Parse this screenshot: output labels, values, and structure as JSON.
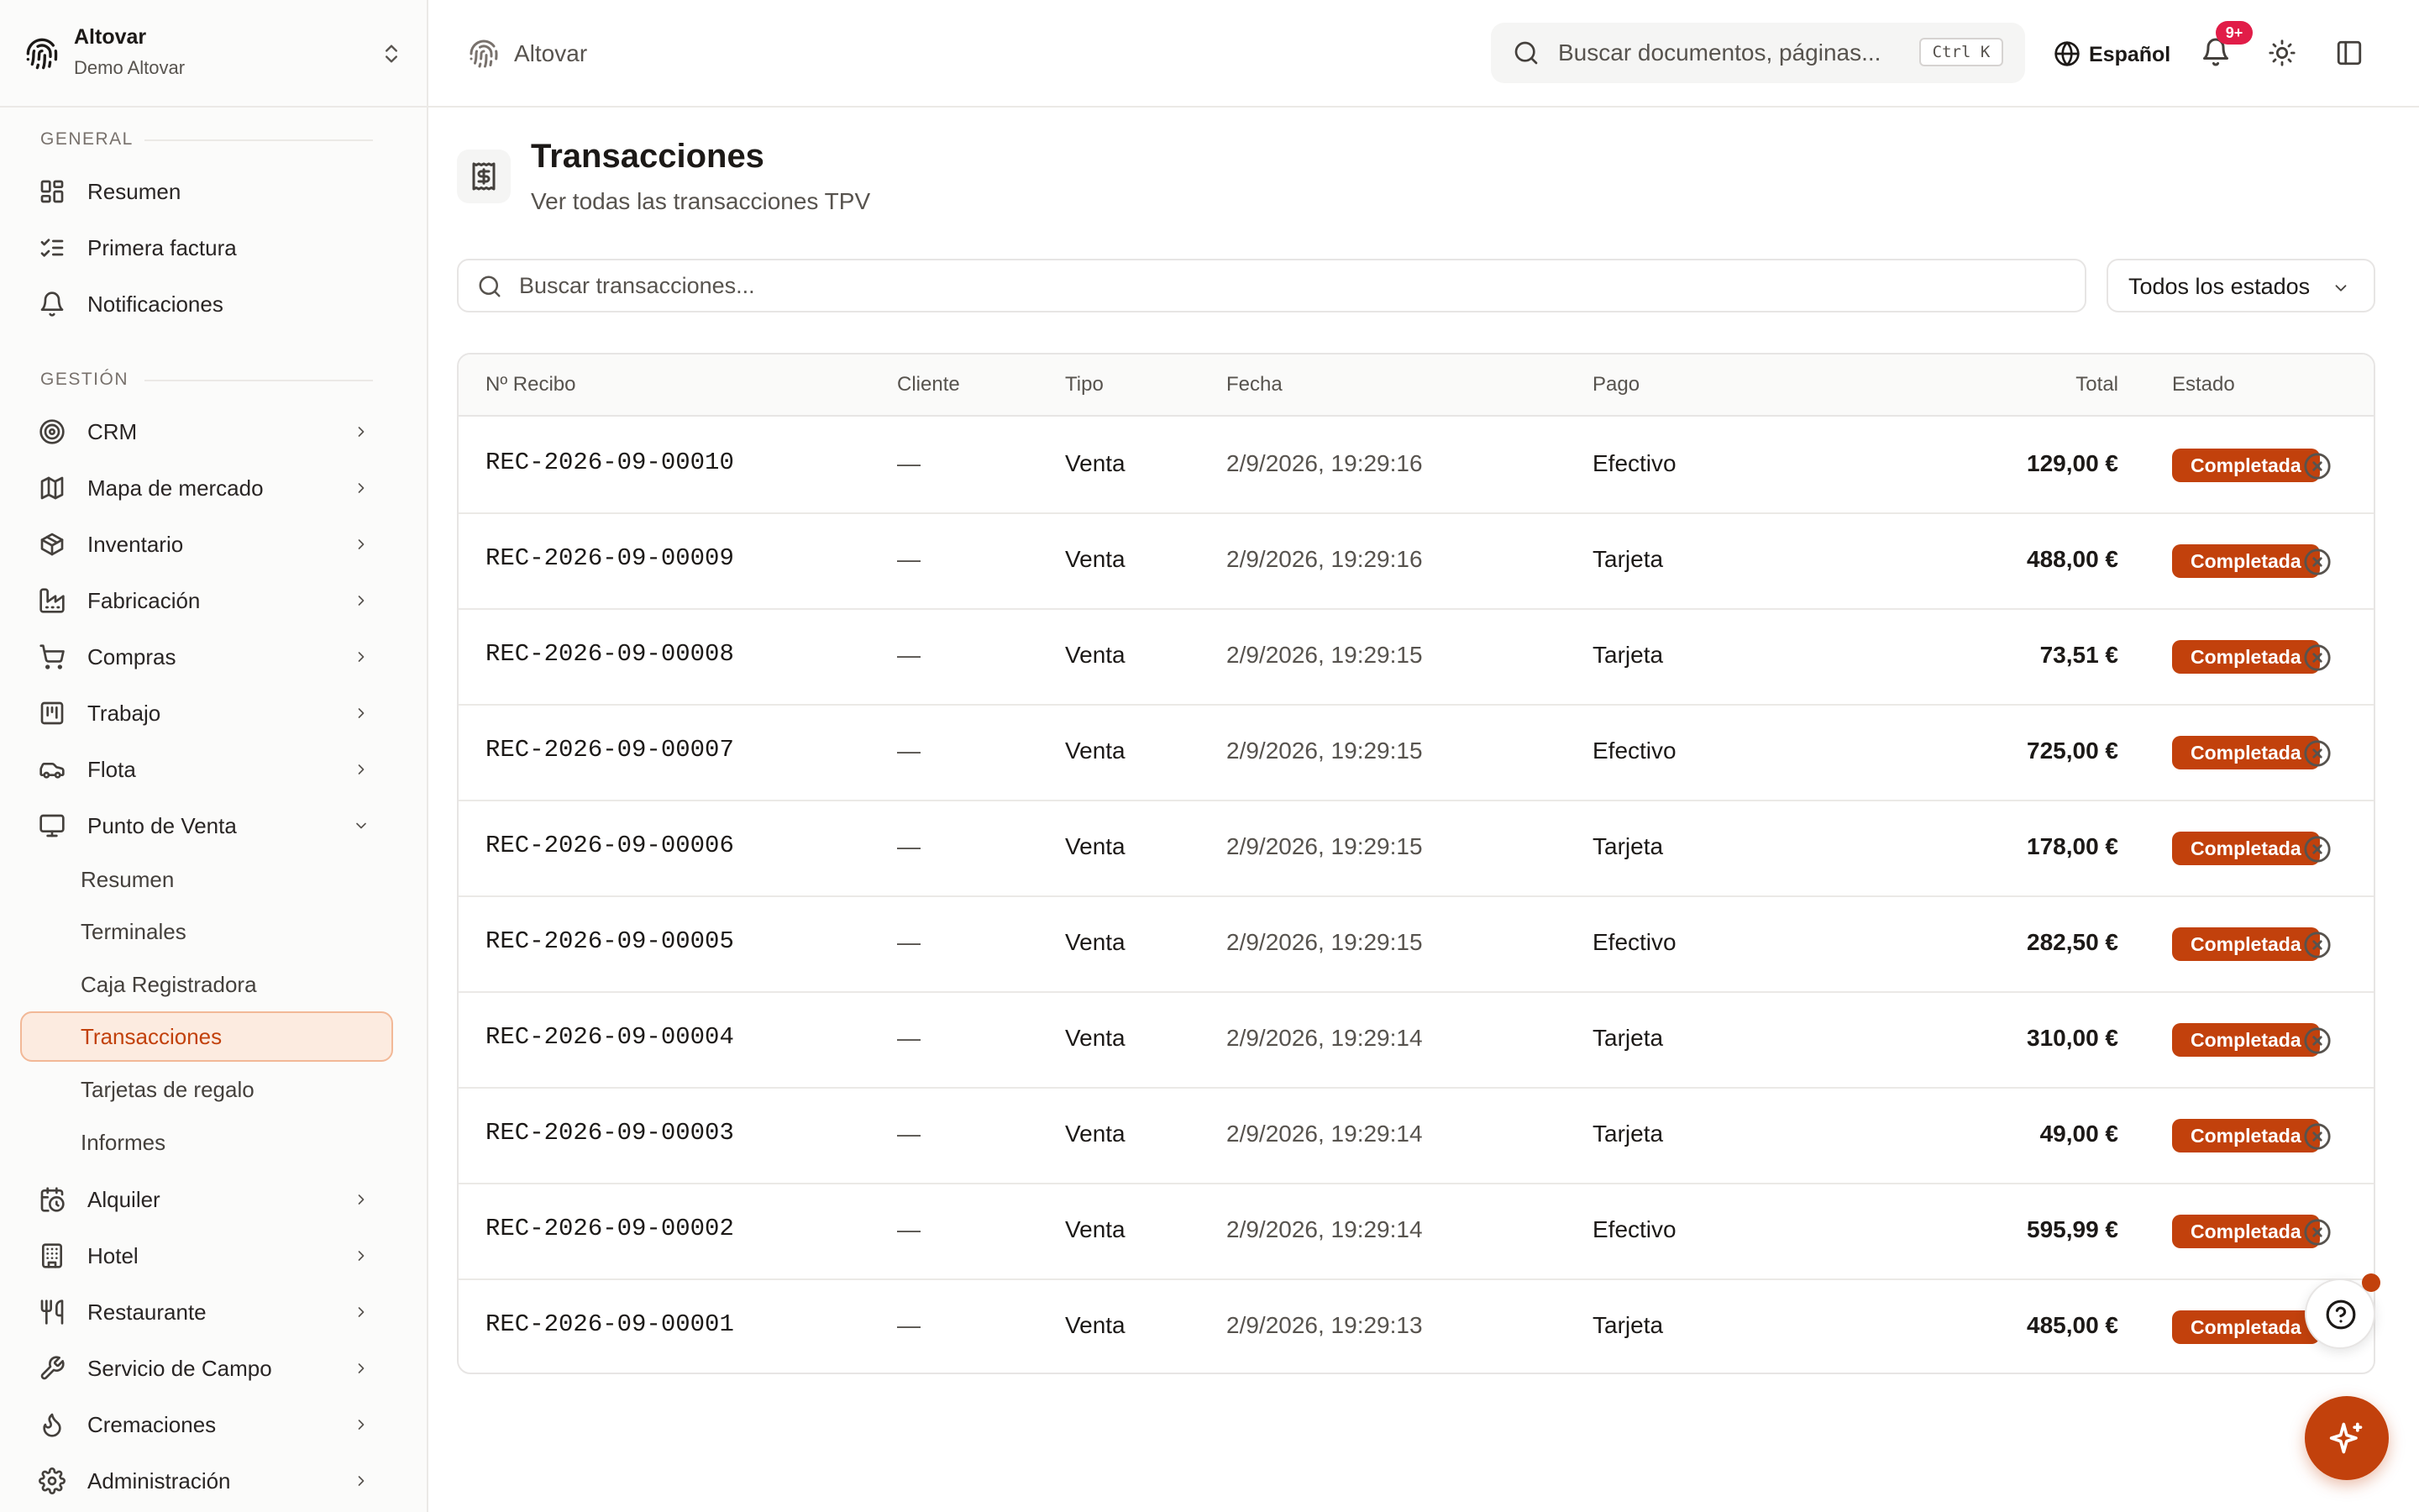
{
  "org": {
    "name": "Altovar",
    "subtitle": "Demo Altovar"
  },
  "sidebar": {
    "sections": [
      {
        "label": "GENERAL"
      },
      {
        "label": "GESTIÓN"
      }
    ],
    "general_items": [
      {
        "label": "Resumen",
        "icon": "layout-dashboard-icon"
      },
      {
        "label": "Primera factura",
        "icon": "list-checks-icon"
      },
      {
        "label": "Notificaciones",
        "icon": "bell-icon"
      }
    ],
    "manage_items": [
      {
        "label": "CRM",
        "icon": "target-icon"
      },
      {
        "label": "Mapa de mercado",
        "icon": "map-icon"
      },
      {
        "label": "Inventario",
        "icon": "package-icon"
      },
      {
        "label": "Fabricación",
        "icon": "factory-icon"
      },
      {
        "label": "Compras",
        "icon": "shopping-cart-icon"
      },
      {
        "label": "Trabajo",
        "icon": "kanban-icon"
      },
      {
        "label": "Flota",
        "icon": "car-icon"
      },
      {
        "label": "Punto de Venta",
        "icon": "monitor-icon"
      }
    ],
    "pos_subitems": [
      {
        "label": "Resumen"
      },
      {
        "label": "Terminales"
      },
      {
        "label": "Caja Registradora"
      },
      {
        "label": "Transacciones",
        "active": true
      },
      {
        "label": "Tarjetas de regalo"
      },
      {
        "label": "Informes"
      }
    ],
    "more_items": [
      {
        "label": "Alquiler",
        "icon": "calendar-clock-icon"
      },
      {
        "label": "Hotel",
        "icon": "building-icon"
      },
      {
        "label": "Restaurante",
        "icon": "utensils-icon"
      },
      {
        "label": "Servicio de Campo",
        "icon": "wrench-icon"
      },
      {
        "label": "Cremaciones",
        "icon": "flame-icon"
      },
      {
        "label": "Administración",
        "icon": "settings-icon"
      }
    ]
  },
  "header": {
    "breadcrumb": "Altovar",
    "search_placeholder": "Buscar documentos, páginas...",
    "shortcut": "Ctrl K",
    "language": "Español",
    "notifications_badge": "9+"
  },
  "page": {
    "title": "Transacciones",
    "subtitle": "Ver todas las transacciones TPV",
    "search_placeholder": "Buscar transacciones...",
    "status_filter": "Todos los estados"
  },
  "table": {
    "columns": [
      "Nº Recibo",
      "Cliente",
      "Tipo",
      "Fecha",
      "Pago",
      "Total",
      "Estado"
    ],
    "rows": [
      {
        "receipt": "REC-2026-09-00010",
        "client": "—",
        "type": "Venta",
        "date": "2/9/2026, 19:29:16",
        "payment": "Efectivo",
        "total": "129,00 €",
        "status": "Completada"
      },
      {
        "receipt": "REC-2026-09-00009",
        "client": "—",
        "type": "Venta",
        "date": "2/9/2026, 19:29:16",
        "payment": "Tarjeta",
        "total": "488,00 €",
        "status": "Completada"
      },
      {
        "receipt": "REC-2026-09-00008",
        "client": "—",
        "type": "Venta",
        "date": "2/9/2026, 19:29:15",
        "payment": "Tarjeta",
        "total": "73,51 €",
        "status": "Completada"
      },
      {
        "receipt": "REC-2026-09-00007",
        "client": "—",
        "type": "Venta",
        "date": "2/9/2026, 19:29:15",
        "payment": "Efectivo",
        "total": "725,00 €",
        "status": "Completada"
      },
      {
        "receipt": "REC-2026-09-00006",
        "client": "—",
        "type": "Venta",
        "date": "2/9/2026, 19:29:15",
        "payment": "Tarjeta",
        "total": "178,00 €",
        "status": "Completada"
      },
      {
        "receipt": "REC-2026-09-00005",
        "client": "—",
        "type": "Venta",
        "date": "2/9/2026, 19:29:15",
        "payment": "Efectivo",
        "total": "282,50 €",
        "status": "Completada"
      },
      {
        "receipt": "REC-2026-09-00004",
        "client": "—",
        "type": "Venta",
        "date": "2/9/2026, 19:29:14",
        "payment": "Tarjeta",
        "total": "310,00 €",
        "status": "Completada"
      },
      {
        "receipt": "REC-2026-09-00003",
        "client": "—",
        "type": "Venta",
        "date": "2/9/2026, 19:29:14",
        "payment": "Tarjeta",
        "total": "49,00 €",
        "status": "Completada"
      },
      {
        "receipt": "REC-2026-09-00002",
        "client": "—",
        "type": "Venta",
        "date": "2/9/2026, 19:29:14",
        "payment": "Efectivo",
        "total": "595,99 €",
        "status": "Completada"
      },
      {
        "receipt": "REC-2026-09-00001",
        "client": "—",
        "type": "Venta",
        "date": "2/9/2026, 19:29:13",
        "payment": "Tarjeta",
        "total": "485,00 €",
        "status": "Completada"
      }
    ]
  },
  "colors": {
    "accent": "#c2410c",
    "accent_soft": "#fcebe0",
    "badge": "#e11d48",
    "border": "#e7e5e4"
  }
}
